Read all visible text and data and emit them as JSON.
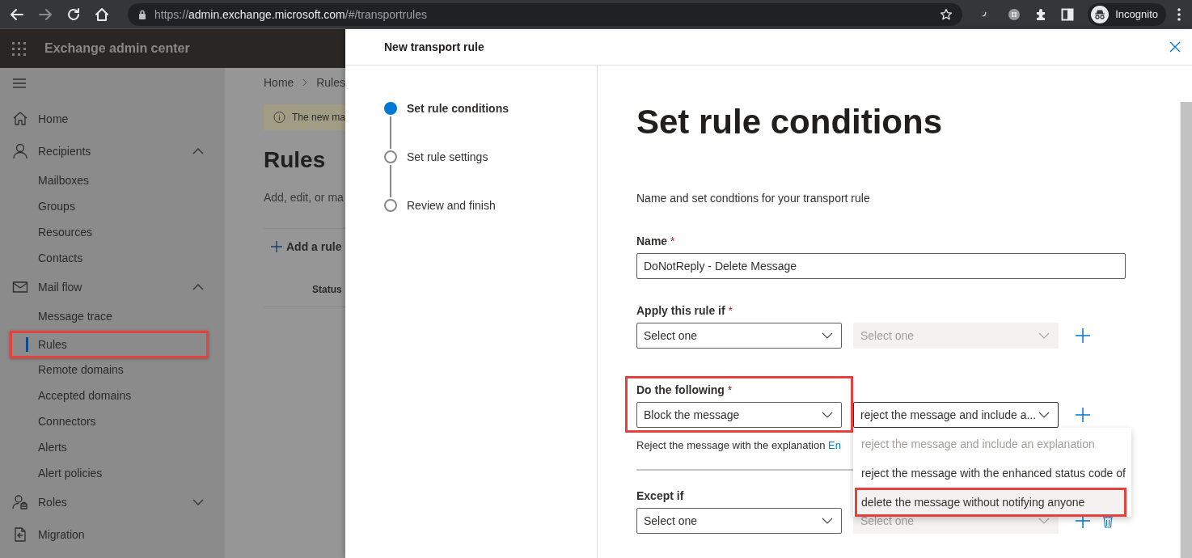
{
  "browser": {
    "url_scheme": "https://",
    "url_host": "admin.exchange.microsoft.com",
    "url_path": "/#/transportrules",
    "profile": "Incognito"
  },
  "app": {
    "title": "Exchange admin center"
  },
  "nav": [
    {
      "label": "Home",
      "selected": false,
      "highlighted": false
    },
    {
      "label": "Recipients",
      "expanded": true,
      "selected": false,
      "highlighted": false,
      "children": [
        {
          "label": "Mailboxes",
          "selected": false,
          "highlighted": false
        },
        {
          "label": "Groups",
          "selected": false,
          "highlighted": false
        },
        {
          "label": "Resources",
          "selected": false,
          "highlighted": false
        },
        {
          "label": "Contacts",
          "selected": false,
          "highlighted": false
        }
      ]
    },
    {
      "label": "Mail flow",
      "expanded": true,
      "selected": false,
      "highlighted": false,
      "children": [
        {
          "label": "Message trace",
          "selected": false,
          "highlighted": false
        },
        {
          "label": "Rules",
          "selected": true,
          "highlighted": true
        },
        {
          "label": "Remote domains",
          "selected": false,
          "highlighted": false
        },
        {
          "label": "Accepted domains",
          "selected": false,
          "highlighted": false
        },
        {
          "label": "Connectors",
          "selected": false,
          "highlighted": false
        },
        {
          "label": "Alerts",
          "selected": false,
          "highlighted": false
        },
        {
          "label": "Alert policies",
          "selected": false,
          "highlighted": false
        }
      ]
    },
    {
      "label": "Roles",
      "expanded": false,
      "selected": false,
      "highlighted": false
    },
    {
      "label": "Migration",
      "selected": false,
      "highlighted": false
    }
  ],
  "background_page": {
    "breadcrumb": [
      "Home",
      "Rules"
    ],
    "banner": "The new ma",
    "heading": "Rules",
    "description": "Add, edit, or ma",
    "add_button": "Add a rule",
    "column_1": "Status"
  },
  "panel": {
    "title": "New transport rule",
    "steps": [
      {
        "label": "Set rule conditions",
        "selected": true
      },
      {
        "label": "Set rule settings",
        "selected": false
      },
      {
        "label": "Review and finish",
        "selected": false
      }
    ],
    "heading": "Set rule conditions",
    "description": "Name and set condtions for your transport rule",
    "name_field": {
      "label": "Name",
      "required_mark": "*",
      "value": "DoNotReply - Delete Message"
    },
    "conditions": [
      {
        "label": "Apply this rule if",
        "required_mark": "*",
        "highlighted": false,
        "selects": [
          {
            "value": "Select one",
            "disabled": false
          },
          {
            "value": "Select one",
            "disabled": true
          }
        ],
        "deletable": false
      },
      {
        "label": "Do the following",
        "required_mark": "*",
        "highlighted": true,
        "selects": [
          {
            "value": "Block the message",
            "disabled": false
          },
          {
            "value": "reject the message and include a...",
            "disabled": false,
            "open": true
          }
        ],
        "deletable": false,
        "note": "Reject the message with the explanation ",
        "note_link": "En",
        "menu": [
          {
            "label": "reject the message and include an explanation",
            "disabled": true,
            "highlighted": false
          },
          {
            "label": "reject the message with the enhanced status code of",
            "disabled": false,
            "highlighted": false
          },
          {
            "label": "delete the message without notifying anyone",
            "disabled": false,
            "highlighted": true
          }
        ]
      },
      {
        "label": "Except if",
        "highlighted": false,
        "divider_before": true,
        "selects": [
          {
            "value": "Select one",
            "disabled": false
          },
          {
            "value": "Select one",
            "disabled": true
          }
        ],
        "deletable": true
      }
    ]
  }
}
